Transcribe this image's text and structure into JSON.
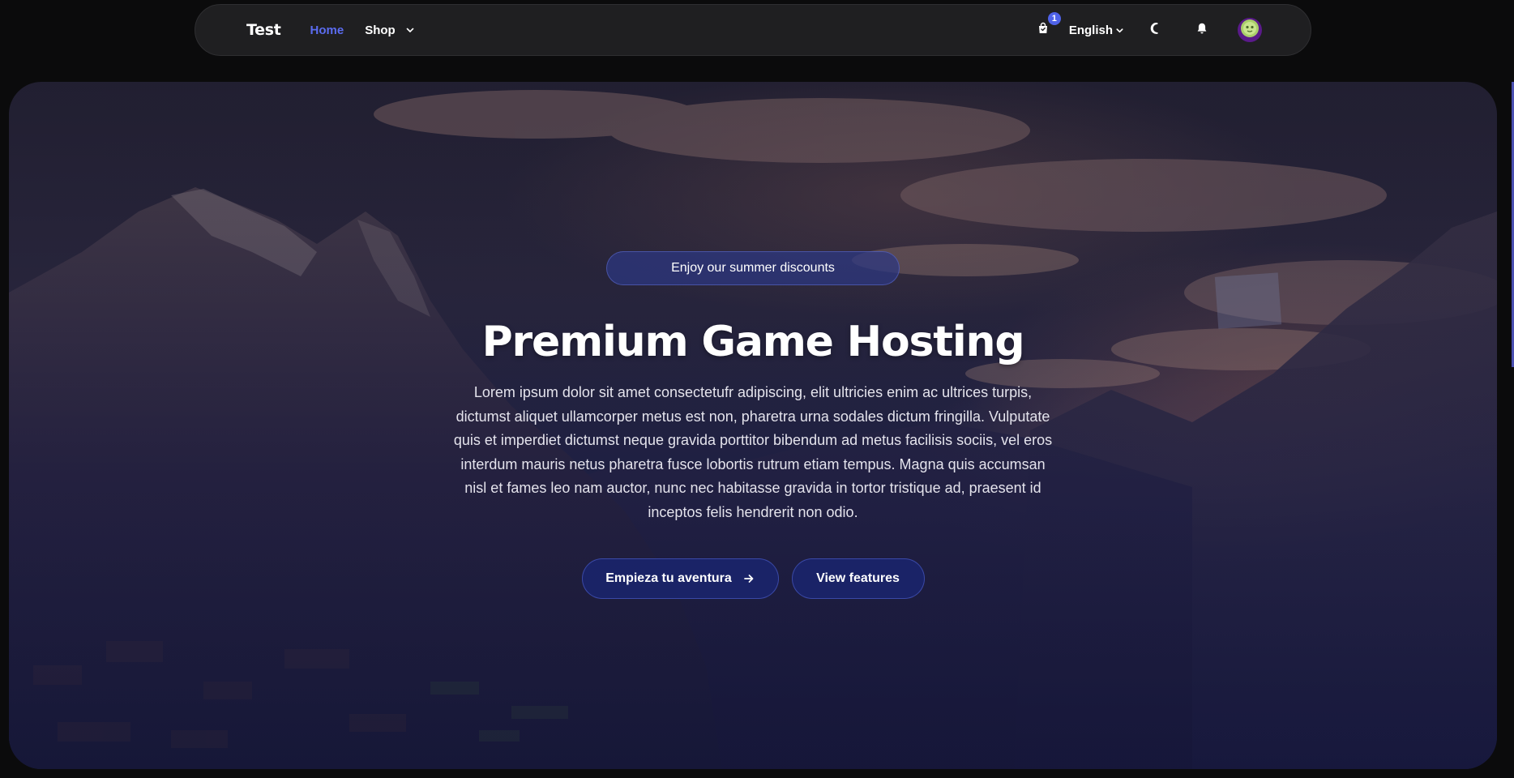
{
  "nav": {
    "brand": "Test",
    "links": [
      {
        "label": "Home",
        "active": true
      },
      {
        "label": "Shop",
        "active": false,
        "has_dropdown": true
      }
    ],
    "cart": {
      "icon": "shopping-bag-icon",
      "count": "1"
    },
    "language": {
      "label": "English",
      "icon": "chevron-down-icon"
    },
    "theme_toggle_icon": "moon-icon",
    "notifications_icon": "bell-icon",
    "avatar_icon": "avatar-icon"
  },
  "hero": {
    "pill_text": "Enjoy our summer discounts",
    "title": "Premium Game Hosting",
    "description": "Lorem ipsum dolor sit amet consectetufr adipiscing, elit ultricies enim ac ultrices turpis, dictumst aliquet ullamcorper metus est non, pharetra urna sodales dictum fringilla. Vulputate quis et imperdiet dictumst neque gravida porttitor bibendum ad metus facilisis sociis, vel eros interdum mauris netus pharetra fusce lobortis rutrum etiam tempus. Magna quis accumsan nisl et fames leo nam auctor, nunc nec habitasse gravida in tortor tristique ad, praesent id inceptos felis hendrerit non odio.",
    "primary_button": {
      "label": "Empieza tu aventura",
      "icon": "arrow-right-icon"
    },
    "secondary_button": {
      "label": "View features"
    }
  },
  "colors": {
    "accent": "#5b6cf0",
    "badge": "#4f62e8",
    "navbar_bg": "#1f1f21",
    "page_bg": "#0b0b0c",
    "button_bg": "#1a246a"
  }
}
